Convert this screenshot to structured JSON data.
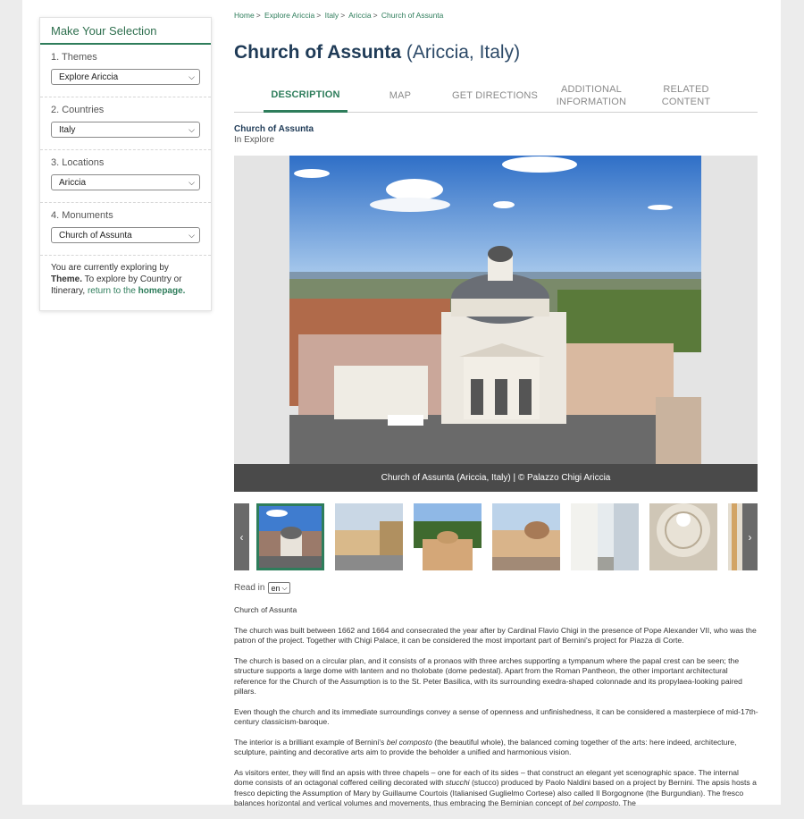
{
  "sidebar": {
    "title": "Make Your Selection",
    "sections": [
      {
        "label": "1. Themes",
        "value": "Explore Ariccia"
      },
      {
        "label": "2. Countries",
        "value": "Italy"
      },
      {
        "label": "3. Locations",
        "value": "Ariccia"
      },
      {
        "label": "4. Monuments",
        "value": "Church of Assunta"
      }
    ],
    "info_prefix": "You are currently exploring by",
    "info_theme": "Theme.",
    "info_middle": "To explore by Country or Itinerary,",
    "info_link": "return to the",
    "info_link_bold": "homepage."
  },
  "breadcrumb": [
    "Home",
    "Explore Ariccia",
    "Italy",
    "Ariccia",
    "Church of Assunta"
  ],
  "title": {
    "name": "Church of Assunta",
    "location": "(Ariccia, Italy)"
  },
  "tabs": [
    {
      "line1": "DESCRIPTION",
      "line2": "",
      "active": true
    },
    {
      "line1": "MAP",
      "line2": "",
      "active": false
    },
    {
      "line1": "GET DIRECTIONS",
      "line2": "",
      "active": false
    },
    {
      "line1": "ADDITIONAL",
      "line2": "INFORMATION",
      "active": false
    },
    {
      "line1": "RELATED",
      "line2": "CONTENT",
      "active": false
    }
  ],
  "subhead": {
    "name": "Church of Assunta",
    "category": "In Explore"
  },
  "hero": {
    "caption": "Church of Assunta (Ariccia, Italy) | © Palazzo Chigi Ariccia"
  },
  "thumbnails": {
    "prev_icon": "chevron-left-icon",
    "next_icon": "chevron-right-icon",
    "count": 7,
    "selected_index": 0
  },
  "read_in": {
    "label": "Read in",
    "value": "en"
  },
  "body": {
    "heading": "Church of Assunta",
    "p1": "The church was built between 1662 and 1664 and consecrated the year after by Cardinal Flavio Chigi in the presence of Pope Alexander VII, who was the patron of the project. Together with Chigi Palace, it can be considered the most important part of Bernini's project for Piazza di Corte.",
    "p2": "The church is based on a circular plan, and it consists of a pronaos with three arches supporting a tympanum where the papal crest can be seen; the structure supports a large dome with lantern and no tholobate (dome pedestal). Apart from the Roman Pantheon, the other important architectural reference for the Church of the Assumption is to the St. Peter Basilica, with its surrounding exedra-shaped colonnade and its propylaea-looking paired pillars.",
    "p3": "Even though the church and its immediate surroundings convey a sense of openness and unfinishedness, it can be considered a masterpiece of mid-17th-century classicism-baroque.",
    "p4a": "The interior is a brilliant example of Bernini's",
    "p4i": "bel composto",
    "p4b": "(the beautiful whole), the balanced coming together of the arts: here indeed, architecture, sculpture, painting and decorative arts aim to provide the beholder a unified and harmonious vision.",
    "p5a": "As visitors enter, they will find an apsis with three chapels – one for each of its sides – that construct an elegant yet scenographic space. The internal dome consists of an octagonal coffered ceiling decorated with",
    "p5i": "stucchi",
    "p5b": "(stucco) produced by Paolo Naldini based on a project by Bernini. The apsis hosts a fresco depicting the Assumption of Mary by Guillaume Courtois (Italianised Guglielmo Cortese) also called Il Borgognone (the Burgundian). The fresco balances horizontal and vertical volumes and movements, thus embracing the Berninian concept of",
    "p5i2": "bel composto",
    "p5c": ". The"
  }
}
